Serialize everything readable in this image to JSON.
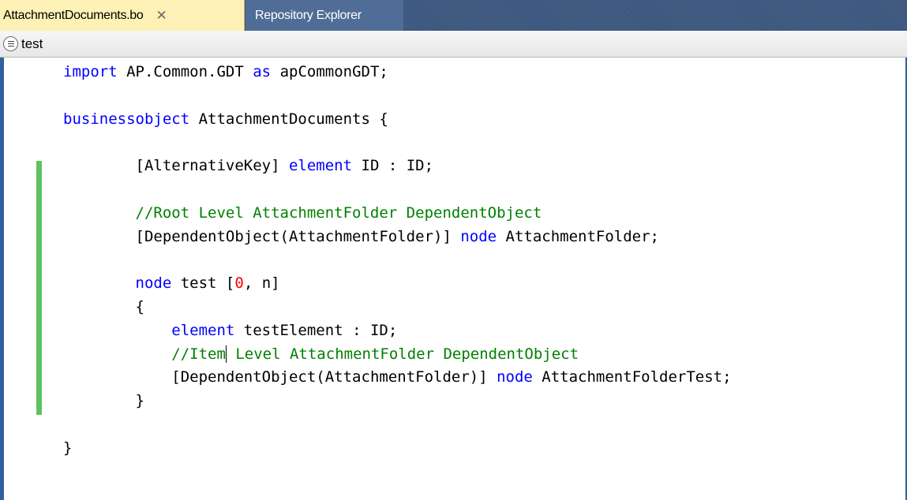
{
  "tabs": [
    {
      "label": "AttachmentDocuments.bo",
      "active": true,
      "close_glyph": "✕"
    },
    {
      "label": "Repository Explorer",
      "active": false
    }
  ],
  "navbar": {
    "icon": "list-circle-icon",
    "label": "test"
  },
  "editor": {
    "language": "ByD Studio Business Object Language",
    "caret": {
      "line": 13,
      "after_text": "//Item"
    },
    "lines": [
      {
        "indent": "",
        "tokens": [
          {
            "t": "import",
            "c": "kw"
          },
          {
            "t": " AP.Common.GDT ",
            "c": ""
          },
          {
            "t": "as",
            "c": "kw"
          },
          {
            "t": " apCommonGDT;",
            "c": ""
          }
        ]
      },
      {
        "indent": "",
        "tokens": []
      },
      {
        "indent": "",
        "tokens": [
          {
            "t": "businessobject",
            "c": "kw"
          },
          {
            "t": " AttachmentDocuments {",
            "c": ""
          }
        ]
      },
      {
        "indent": "",
        "tokens": []
      },
      {
        "indent": "        ",
        "tokens": [
          {
            "t": "[AlternativeKey] ",
            "c": ""
          },
          {
            "t": "element",
            "c": "kw"
          },
          {
            "t": " ID : ID;",
            "c": ""
          }
        ]
      },
      {
        "indent": "",
        "tokens": []
      },
      {
        "indent": "        ",
        "tokens": [
          {
            "t": "//Root Level AttachmentFolder DependentObject",
            "c": "cm"
          }
        ]
      },
      {
        "indent": "        ",
        "tokens": [
          {
            "t": "[DependentObject(AttachmentFolder)] ",
            "c": ""
          },
          {
            "t": "node",
            "c": "kw"
          },
          {
            "t": " AttachmentFolder;",
            "c": ""
          }
        ]
      },
      {
        "indent": "",
        "tokens": []
      },
      {
        "indent": "        ",
        "tokens": [
          {
            "t": "node",
            "c": "kw"
          },
          {
            "t": " test [",
            "c": ""
          },
          {
            "t": "0",
            "c": "num"
          },
          {
            "t": ", n]",
            "c": ""
          }
        ]
      },
      {
        "indent": "        ",
        "tokens": [
          {
            "t": "{",
            "c": ""
          }
        ]
      },
      {
        "indent": "            ",
        "tokens": [
          {
            "t": "element",
            "c": "kw"
          },
          {
            "t": " testElement : ID;",
            "c": ""
          }
        ]
      },
      {
        "indent": "            ",
        "tokens": [
          {
            "t": "//Item",
            "c": "cm"
          },
          {
            "t": "",
            "c": "caret"
          },
          {
            "t": " Level AttachmentFolder DependentObject",
            "c": "cm"
          }
        ]
      },
      {
        "indent": "            ",
        "tokens": [
          {
            "t": "[DependentObject(AttachmentFolder)] ",
            "c": ""
          },
          {
            "t": "node",
            "c": "kw"
          },
          {
            "t": " AttachmentFolderTest;",
            "c": ""
          }
        ]
      },
      {
        "indent": "        ",
        "tokens": [
          {
            "t": "}",
            "c": ""
          }
        ]
      },
      {
        "indent": "",
        "tokens": []
      },
      {
        "indent": "",
        "tokens": [
          {
            "t": "}",
            "c": ""
          }
        ]
      }
    ]
  },
  "colors": {
    "keyword": "#0000ff",
    "comment": "#008000",
    "number": "#ff0000",
    "change_marker": "#5fc15f",
    "active_tab": "#fdf1b6",
    "tab_strip": "#3e5981"
  }
}
